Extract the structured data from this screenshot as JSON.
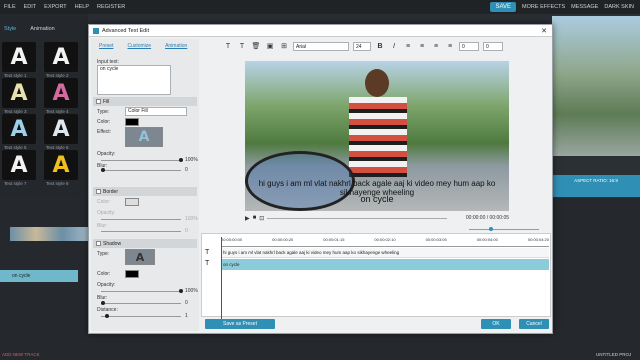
{
  "menu": {
    "items": [
      "FILE",
      "EDIT",
      "EXPORT",
      "HELP",
      "REGISTER"
    ],
    "save": "SAVE",
    "more_effects": "MORE EFFECTS",
    "message": "MESSAGE",
    "dark_skin": "DARK SKIN"
  },
  "left_panel": {
    "tabs": [
      "Style",
      "Animation"
    ],
    "tiles": [
      {
        "glyph": "A",
        "label": "Text style 1"
      },
      {
        "glyph": "A",
        "label": "Text style 2"
      },
      {
        "glyph": "A",
        "label": "Text style 3"
      },
      {
        "glyph": "A",
        "label": "Text style 4"
      },
      {
        "glyph": "A",
        "label": "Text style 5"
      },
      {
        "glyph": "A",
        "label": "Text style 6"
      },
      {
        "glyph": "A",
        "label": "Text style 7"
      },
      {
        "glyph": "A",
        "label": "Text style 8"
      }
    ]
  },
  "right_panel": {
    "ratio_label": "ASPECT RATIO: 16:9",
    "ratio_value": "16:9"
  },
  "dialog": {
    "title": "Advanced Text Edit",
    "tabs": [
      "Preset",
      "Customize",
      "Animation"
    ],
    "input_label": "Input text:",
    "input_value": "on cycle",
    "fill": {
      "label": "Fill",
      "type_label": "Type:",
      "type_value": "Color Fill",
      "color_label": "Color:",
      "effect_label": "Effect:",
      "opacity_label": "Opacity:",
      "opacity_value": "100%",
      "blur_label": "Blur:",
      "blur_value": "0"
    },
    "border": {
      "label": "Border",
      "color_label": "Color:",
      "opacity_label": "Opacity:",
      "opacity_value": "100%",
      "blur_label": "Blur:",
      "blur_value": "0"
    },
    "shadow": {
      "label": "Shadow",
      "type_label": "Type:",
      "color_label": "Color:",
      "opacity_label": "Opacity:",
      "opacity_value": "100%",
      "blur_label": "Blur:",
      "blur_value": "0",
      "distance_label": "Distance:",
      "distance_value": "1"
    },
    "toolbar": {
      "font": "Arial",
      "size": "24",
      "spacing1": "0",
      "spacing2": "0"
    },
    "video": {
      "caption_main": "hi guys i am ml vlat nakhrl back agale aaj ki video mey hum aap ko sikhayenge wheeling",
      "caption_sub": "on cycle"
    },
    "player": {
      "time": "00:00:00 / 00:00:05"
    },
    "timeline": {
      "ruler": [
        "00:00:00:00",
        "00:00:00:20",
        "00:00:01:15",
        "00:00:02:10",
        "00:00:03:05",
        "00:00:04:00",
        "00:00:04:20"
      ],
      "row1_text": "hi guys i am ml vlat nakhrl back agale aaj ki video mey hum aap ko sikhayenge wheeling",
      "row2_text": "on cycle"
    },
    "save_preset": "Save as Preset",
    "ok": "OK",
    "cancel": "Cancel"
  },
  "bottom": {
    "add_track": "ADD NEW TRACK",
    "project": "UNTITLED PROJ"
  },
  "colors": {
    "accent": "#2f8fb5",
    "fill_color": "#000000"
  }
}
